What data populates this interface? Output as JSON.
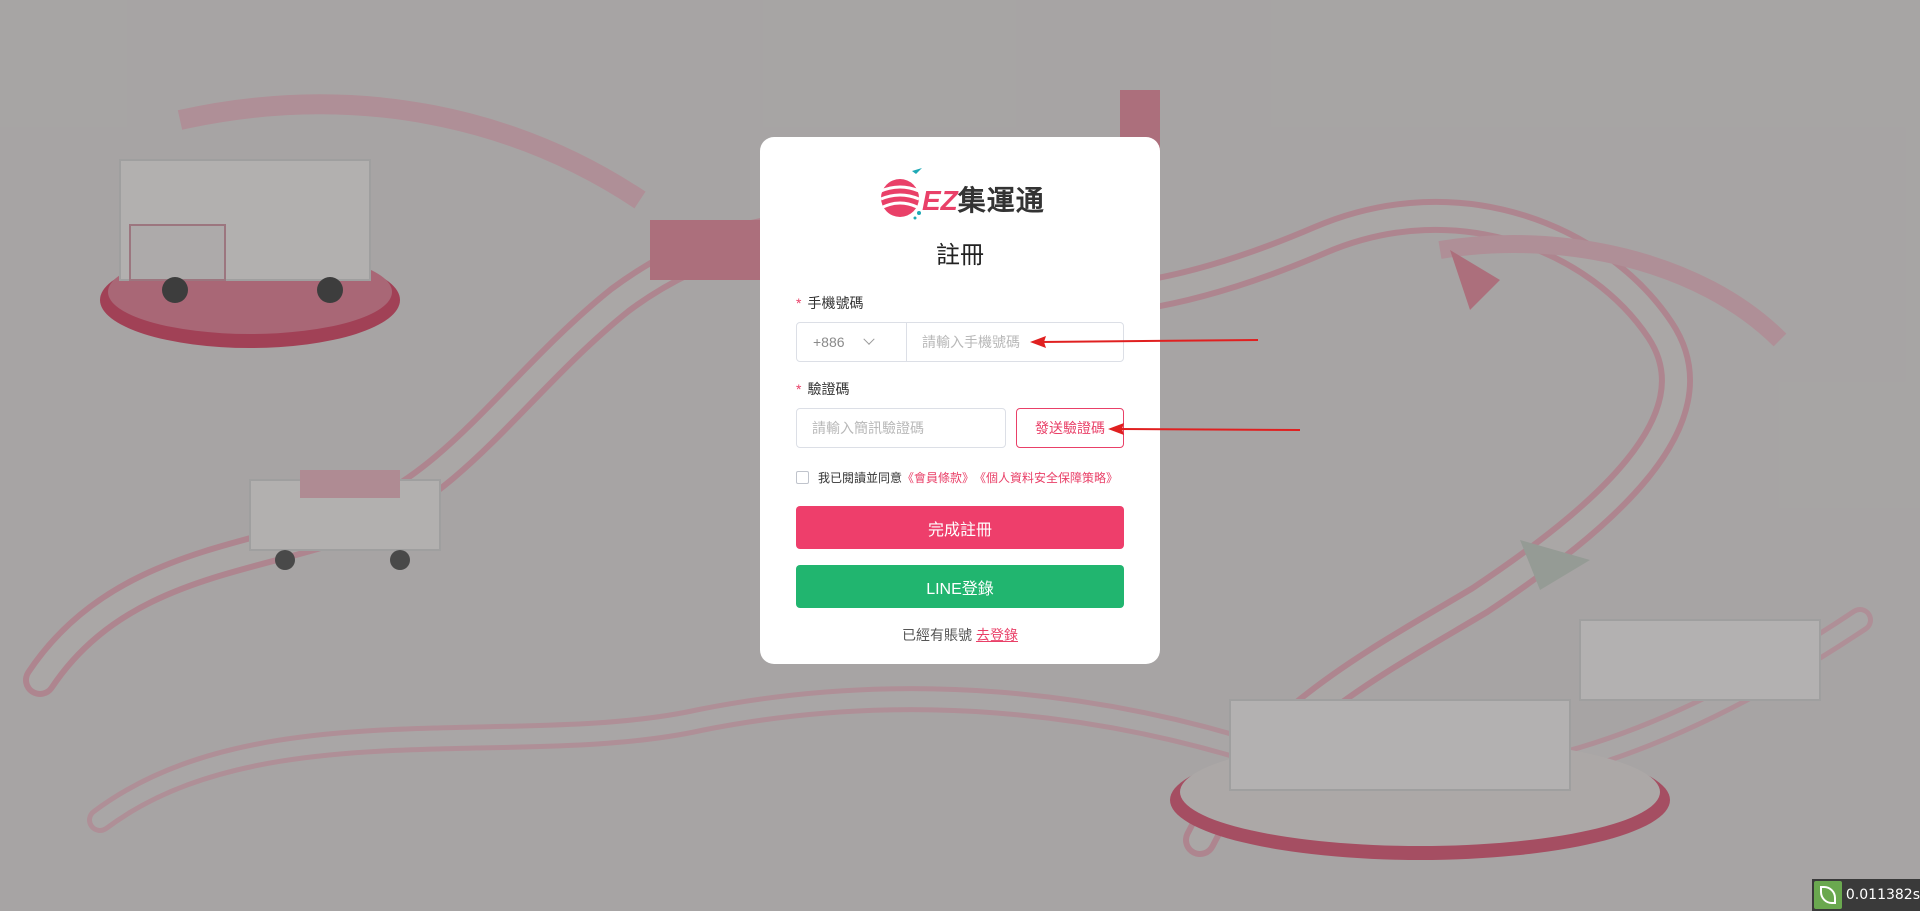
{
  "brand": {
    "logo_ez": "EZ",
    "logo_name": "集運通"
  },
  "form": {
    "title": "註冊",
    "phone_label": "手機號碼",
    "required_mark": "*",
    "country_code": "+886",
    "phone_placeholder": "請輸入手機號碼",
    "code_label": "驗證碼",
    "code_placeholder": "請輸入簡訊驗證碼",
    "send_code_button": "發送驗證碼",
    "agree_text": "我已閱讀並同意",
    "terms_link": "《會員條款》",
    "privacy_link": "《個人資料安全保障策略》",
    "register_button": "完成註冊",
    "line_login_button": "LINE登錄",
    "have_account_text": "已經有賬號",
    "go_login_link": "去登錄"
  },
  "overlay": {
    "timer_text": "0.011382s"
  },
  "colors": {
    "accent": "#e94068",
    "register": "#ee3e6b",
    "line": "#21b56f",
    "annotation_arrow": "#e02020"
  }
}
